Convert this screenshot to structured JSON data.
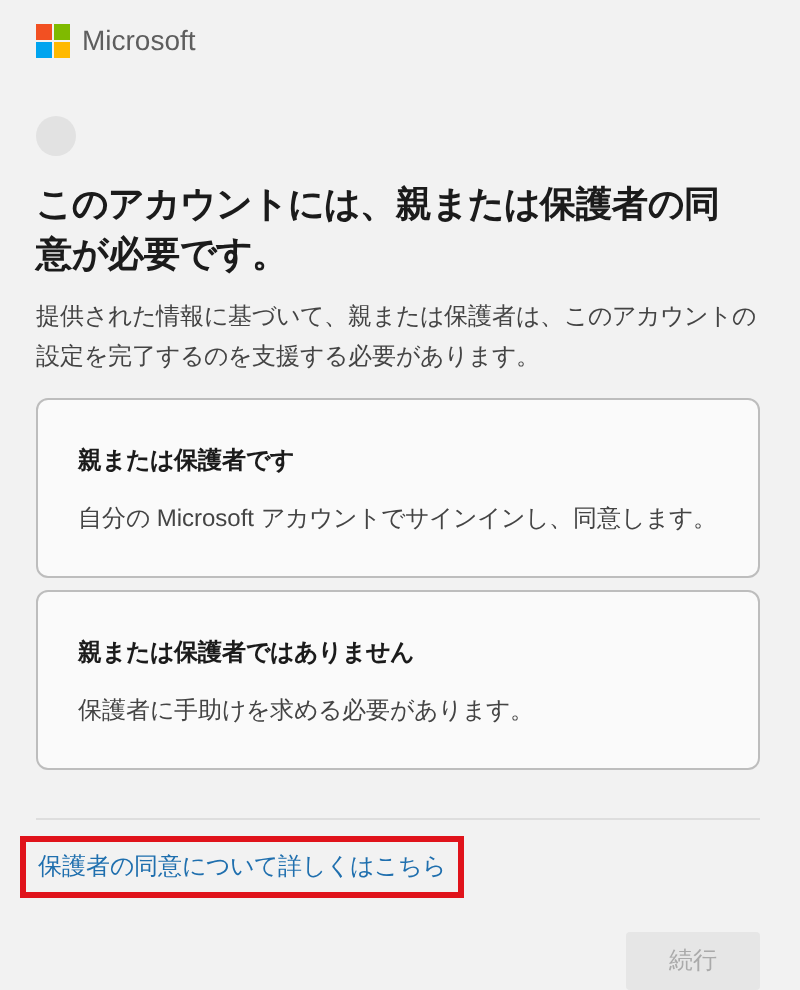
{
  "brand": {
    "name": "Microsoft"
  },
  "heading": "このアカウントには、親または保護者の同意が必要です。",
  "description": "提供された情報に基づいて、親または保護者は、このアカウントの設定を完了するのを支援する必要があります。",
  "options": [
    {
      "title": "親または保護者です",
      "detail": "自分の Microsoft アカウントでサインインし、同意します。",
      "selected": false
    },
    {
      "title": "親または保護者ではありません",
      "detail": "保護者に手助けを求める必要があります。",
      "selected": false
    }
  ],
  "link": {
    "label": "保護者の同意について詳しくはこちら",
    "highlighted": true
  },
  "continue_button": {
    "label": "続行",
    "disabled": true
  }
}
